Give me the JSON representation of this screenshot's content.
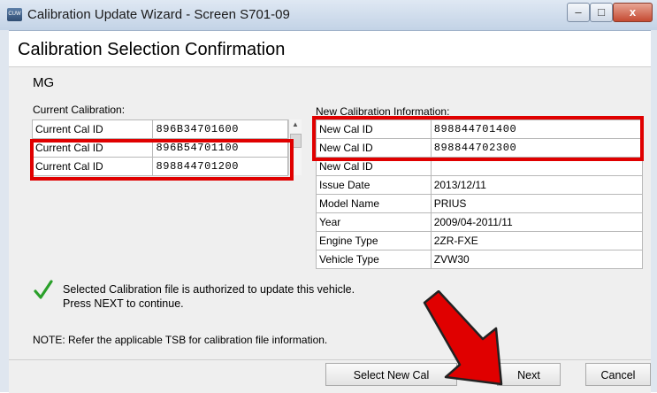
{
  "window": {
    "title": "Calibration Update Wizard - Screen S701-09",
    "icon_name": "app-icon",
    "icon_text": "CUW",
    "controls": {
      "minimize": "–",
      "maximize": "□",
      "close": "x"
    }
  },
  "page": {
    "title": "Calibration Selection Confirmation",
    "system": "MG"
  },
  "current_calibration": {
    "label": "Current Calibration:",
    "rows": [
      {
        "label": "Current Cal ID",
        "value": "896B34701600"
      },
      {
        "label": "Current Cal ID",
        "value": "896B54701100"
      },
      {
        "label": "Current Cal ID",
        "value": "898844701200"
      }
    ]
  },
  "new_calibration": {
    "label": "New Calibration Information:",
    "rows": [
      {
        "label": "New Cal ID",
        "value": "898844701400"
      },
      {
        "label": "New Cal ID",
        "value": "898844702300"
      },
      {
        "label": "New Cal ID",
        "value": ""
      },
      {
        "label": "Issue Date",
        "value": "2013/12/11"
      },
      {
        "label": "Model Name",
        "value": "PRIUS"
      },
      {
        "label": "Year",
        "value": "2009/04-2011/11"
      },
      {
        "label": "Engine Type",
        "value": "2ZR-FXE"
      },
      {
        "label": "Vehicle Type",
        "value": "ZVW30"
      }
    ]
  },
  "status": {
    "icon_name": "checkmark-icon",
    "line1": "Selected Calibration file is authorized to update this vehicle.",
    "line2": "Press NEXT to continue."
  },
  "note": "NOTE: Refer the applicable TSB for calibration file information.",
  "buttons": {
    "select_new_cal": "Select New Cal",
    "next": "Next",
    "cancel": "Cancel"
  },
  "colors": {
    "highlight": "#e00000",
    "check": "#2aa02a"
  }
}
